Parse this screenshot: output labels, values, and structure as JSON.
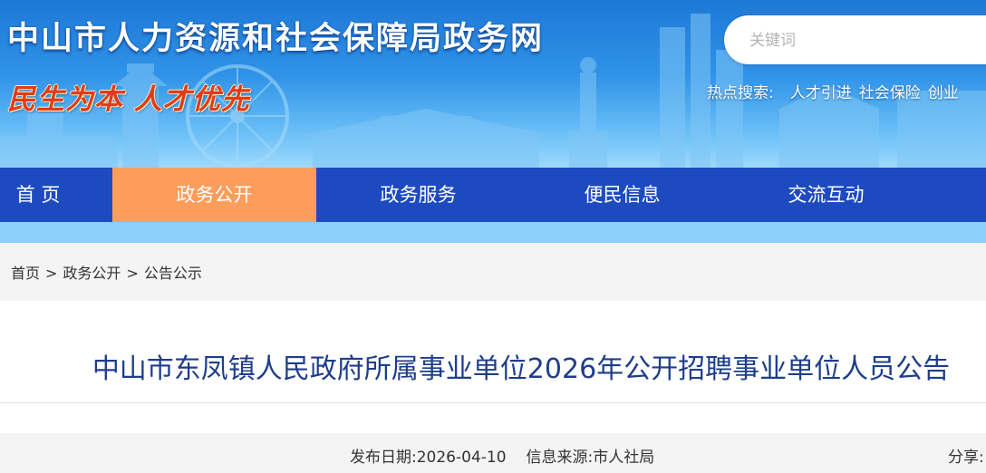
{
  "header": {
    "site_title": "中山市人力资源和社会保障局政务网",
    "slogan": "民生为本  人才优先",
    "search": {
      "placeholder": "关键词"
    },
    "hot_search": {
      "label": "热点搜索:",
      "links": [
        "人才引进",
        "社会保险",
        "创业"
      ]
    }
  },
  "nav": {
    "items": [
      {
        "label": "首 页"
      },
      {
        "label": "政务公开",
        "active": true
      },
      {
        "label": "政务服务"
      },
      {
        "label": "便民信息"
      },
      {
        "label": "交流互动"
      }
    ]
  },
  "breadcrumb": {
    "items": [
      "首页",
      "政务公开",
      "公告公示"
    ],
    "separator": ">"
  },
  "article": {
    "title": "中山市东凤镇人民政府所属事业单位2026年公开招聘事业单位人员公告",
    "publish_date_label": "发布日期:",
    "publish_date": "2026-04-10",
    "source_label": "信息来源:",
    "source": "市人社局",
    "share_label": "分享:"
  },
  "colors": {
    "nav_bg": "#1d4bbf",
    "nav_active": "#fc9d5c",
    "title": "#1e3e8c",
    "slogan": "#e23a1c"
  }
}
